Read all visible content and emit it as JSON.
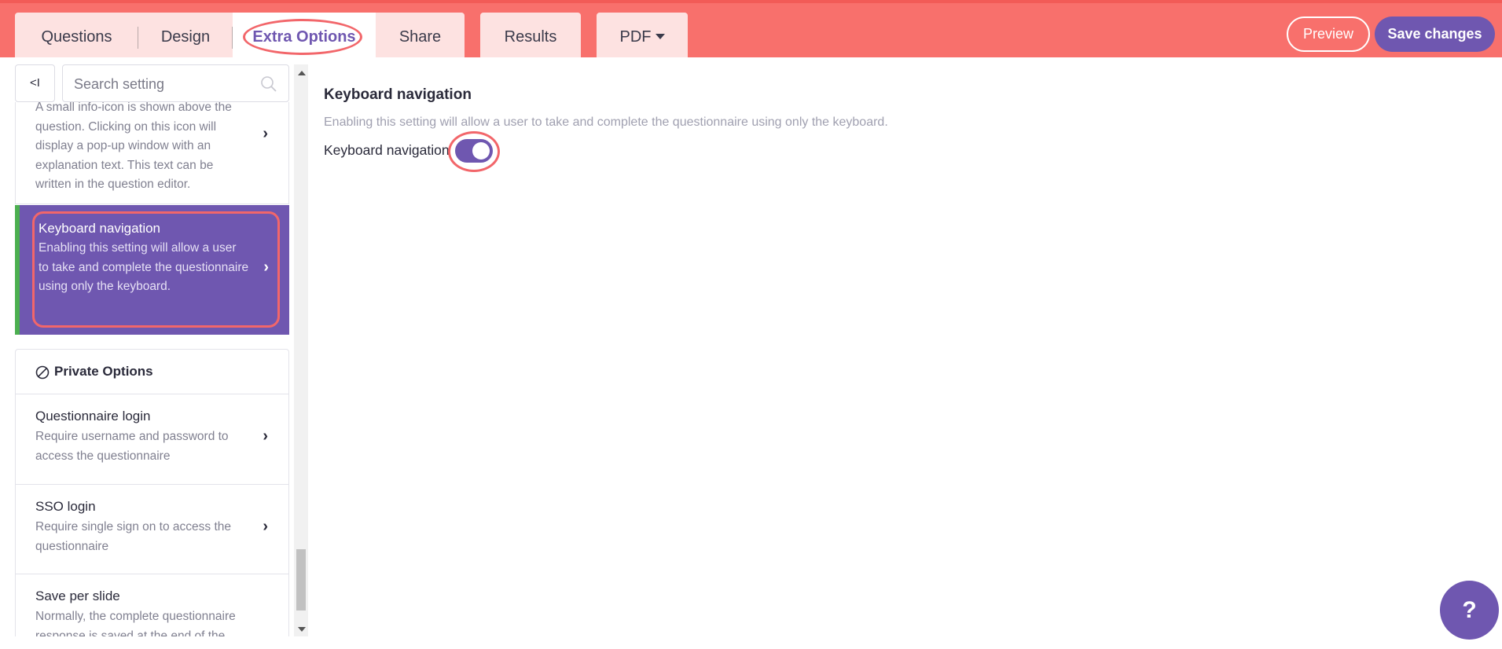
{
  "tabs": {
    "questions": "Questions",
    "design": "Design",
    "extra_options": "Extra Options",
    "share": "Share",
    "results": "Results",
    "pdf": "PDF"
  },
  "actions": {
    "preview": "Preview",
    "save": "Save changes"
  },
  "sidebar": {
    "collapse_label": "<I",
    "search_placeholder": "Search setting",
    "items": [
      {
        "title": "",
        "desc": "A small info-icon is shown above the question. Clicking on this icon will display a pop-up window with an explanation text. This text can be written in the question editor."
      },
      {
        "title": "Keyboard navigation",
        "desc": "Enabling this setting will allow a user to take and complete the questionnaire using only the keyboard.",
        "active": true
      }
    ],
    "section": {
      "title": "Private Options",
      "items": [
        {
          "title": "Questionnaire login",
          "desc": "Require username and password to access the questionnaire"
        },
        {
          "title": "SSO login",
          "desc": "Require single sign on to access the questionnaire"
        },
        {
          "title": "Save per slide",
          "desc": "Normally, the complete questionnaire response is saved at the end of the"
        }
      ]
    },
    "chevron": "›"
  },
  "main": {
    "title": "Keyboard navigation",
    "description": "Enabling this setting will allow a user to take and complete the questionnaire using only the keyboard.",
    "toggle_label": "Keyboard navigation",
    "toggle_on": true
  },
  "help": {
    "label": "?"
  },
  "colors": {
    "header": "#f8706c",
    "accent": "#6f57b0",
    "highlight_ring": "#f2666a",
    "active_bar": "#4caf50"
  }
}
